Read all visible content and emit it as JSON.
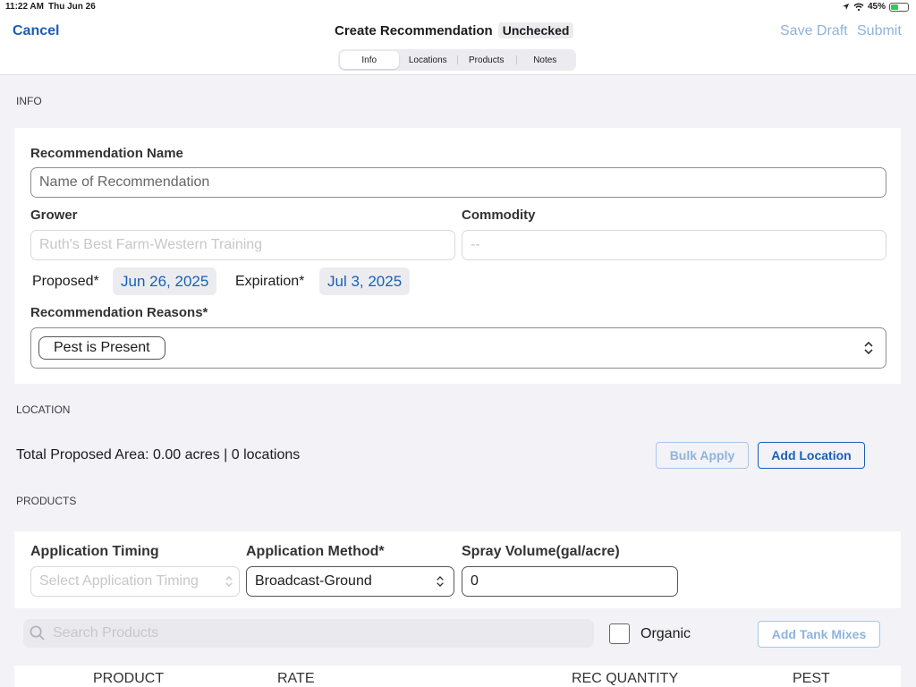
{
  "status_bar": {
    "time": "11:22 AM",
    "date": "Thu Jun 26",
    "battery_percent": "45%",
    "battery_level": 0.45,
    "icons": [
      "location-arrow-icon",
      "wifi-icon",
      "battery-charging-icon"
    ]
  },
  "nav": {
    "cancel_label": "Cancel",
    "title": "Create Recommendation",
    "badge": "Unchecked",
    "save_draft_label": "Save Draft",
    "submit_label": "Submit",
    "tabs": [
      {
        "label": "Info",
        "active": true
      },
      {
        "label": "Locations",
        "active": false
      },
      {
        "label": "Products",
        "active": false
      },
      {
        "label": "Notes",
        "active": false
      }
    ]
  },
  "info": {
    "section_title": "INFO",
    "rec_name_label": "Recommendation Name",
    "rec_name_placeholder": "Name of Recommendation",
    "grower_label": "Grower",
    "grower_value": "Ruth's Best Farm-Western Training",
    "commodity_label": "Commodity",
    "commodity_value": "--",
    "proposed_label": "Proposed*",
    "proposed_date": "Jun 26, 2025",
    "expiration_label": "Expiration*",
    "expiration_date": "Jul 3, 2025",
    "reasons_label": "Recommendation Reasons*",
    "reasons": [
      "Pest is Present"
    ]
  },
  "location": {
    "section_title": "LOCATION",
    "total_text": "Total Proposed Area: 0.00 acres | 0 locations",
    "bulk_apply_label": "Bulk Apply",
    "add_location_label": "Add Location"
  },
  "products": {
    "section_title": "PRODUCTS",
    "timing_label": "Application Timing",
    "timing_placeholder": "Select Application Timing",
    "method_label": "Application Method*",
    "method_value": "Broadcast-Ground",
    "spray_label": "Spray Volume(gal/acre)",
    "spray_value": "0",
    "search_placeholder": "Search Products",
    "organic_label": "Organic",
    "organic_checked": false,
    "add_tank_mixes_label": "Add Tank Mixes",
    "columns": [
      "PRODUCT",
      "RATE",
      "REC QUANTITY",
      "PEST"
    ]
  },
  "colors": {
    "accent": "#1a5fb4",
    "accent_disabled": "#8fb3dc",
    "background": "#f2f2f7",
    "battery": "#34c759"
  }
}
